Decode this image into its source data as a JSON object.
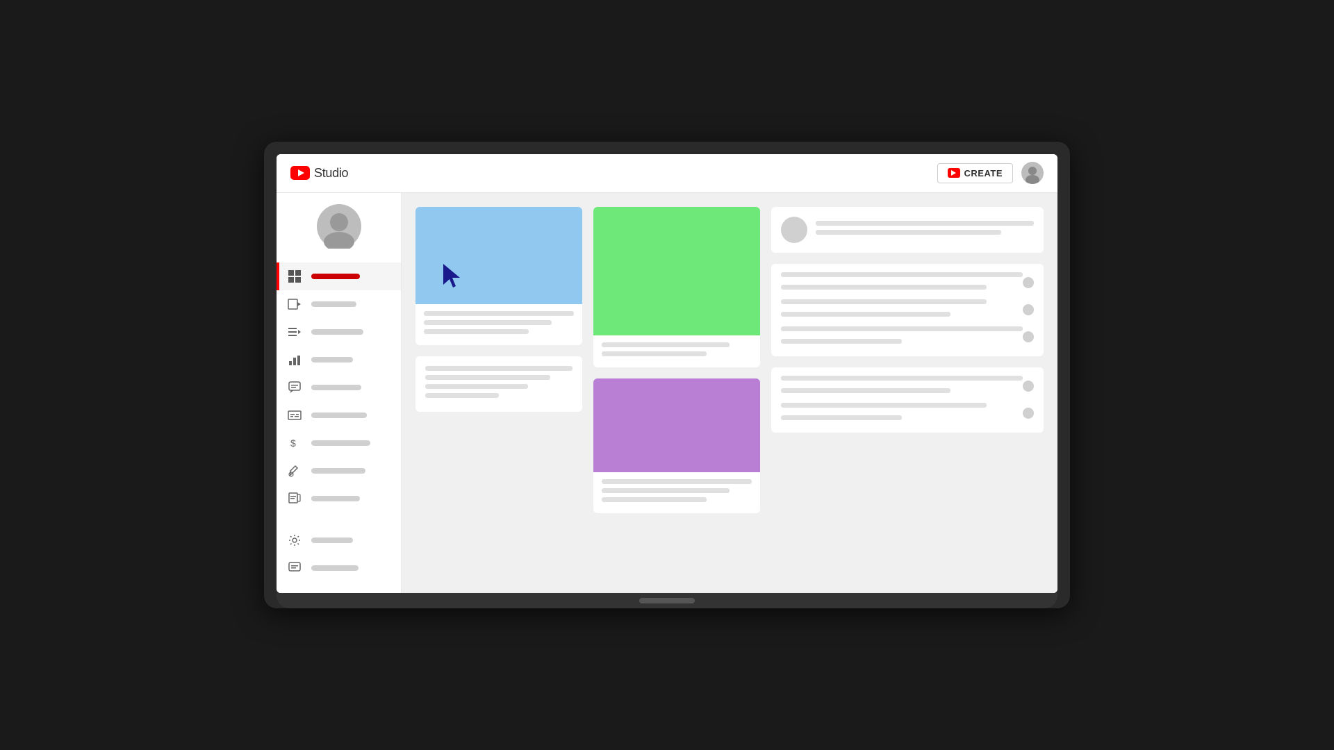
{
  "app": {
    "title": "YouTube Studio"
  },
  "header": {
    "logo_text": "Studio",
    "create_label": "CREATE",
    "create_icon": "video-camera-icon"
  },
  "sidebar": {
    "nav_items": [
      {
        "id": "dashboard",
        "icon": "grid-icon",
        "active": true
      },
      {
        "id": "content",
        "icon": "video-icon",
        "active": false
      },
      {
        "id": "playlists",
        "icon": "playlist-icon",
        "active": false
      },
      {
        "id": "analytics",
        "icon": "analytics-icon",
        "active": false
      },
      {
        "id": "comments",
        "icon": "comments-icon",
        "active": false
      },
      {
        "id": "subtitles",
        "icon": "subtitles-icon",
        "active": false
      },
      {
        "id": "monetization",
        "icon": "dollar-icon",
        "active": false
      },
      {
        "id": "customization",
        "icon": "brush-icon",
        "active": false
      },
      {
        "id": "audiolib",
        "icon": "audio-icon",
        "active": false
      }
    ],
    "bottom_items": [
      {
        "id": "settings",
        "icon": "gear-icon"
      },
      {
        "id": "feedback",
        "icon": "feedback-icon"
      }
    ]
  },
  "content": {
    "card1": {
      "thumbnail_color": "#90c8f0",
      "lines": [
        "long",
        "medium",
        "short",
        "xshort"
      ]
    },
    "card2_top": {
      "thumbnail_color": "#6fe87a"
    },
    "card2_bottom": {
      "thumbnail_color": "#b87fd4"
    },
    "card3_profile": {
      "lines": [
        "long",
        "medium"
      ]
    },
    "card3_list": {
      "rows": [
        {
          "lines": [
            "long",
            "medium"
          ]
        },
        {
          "lines": [
            "medium",
            "short"
          ]
        },
        {
          "lines": [
            "long",
            "xshort"
          ]
        }
      ]
    },
    "card_bottom_left": {
      "lines": [
        "long",
        "medium",
        "short",
        "xshort"
      ]
    }
  }
}
